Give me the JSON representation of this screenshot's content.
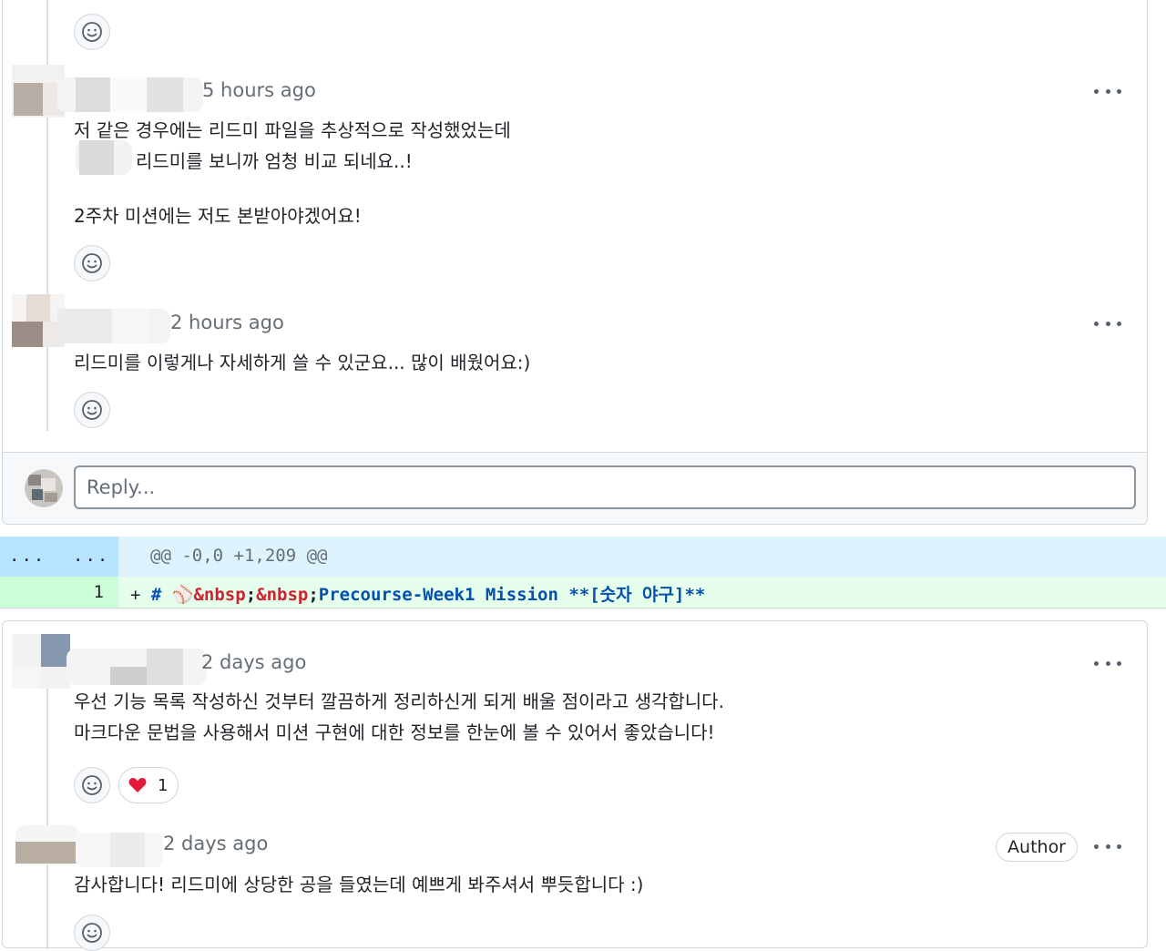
{
  "thread1": {
    "comments": [
      {
        "time": "5 hours ago",
        "lines": [
          "저 같은 경우에는 리드미 파일을 추상적으로 작성했었는데",
          "리드미를 보니까 엄청 비교 되네요..!",
          "2주차 미션에는 저도 본받아야겠어요!"
        ]
      },
      {
        "time": "2 hours ago",
        "lines": [
          "리드미를 이렇게나 자세하게 쓸 수 있군요... 많이 배웠어요:)"
        ]
      }
    ],
    "reply_placeholder": "Reply..."
  },
  "diff": {
    "expand_left": "...",
    "expand_right": "...",
    "hunk_header": "@@ -0,0 +1,209 @@",
    "line_number": "1",
    "plus": "+",
    "code_hash": "#",
    "code_emoji": "⚾",
    "code_nbsp1": "&nbsp",
    "code_semi1": ";",
    "code_nbsp2": "&nbsp",
    "code_semi2": ";",
    "code_title": "Precourse-Week1 Mission ",
    "code_bold": "**[숫자 야구]**"
  },
  "thread2": {
    "comments": [
      {
        "time": "2 days ago",
        "lines": [
          "우선 기능 목록 작성하신 것부터 깔끔하게 정리하신게 되게 배울 점이라고 생각합니다.",
          "마크다운 문법을 사용해서 미션 구현에 대한 정보를 한눈에 볼 수 있어서 좋았습니다!"
        ],
        "reaction": {
          "emoji": "heart-icon",
          "count": "1"
        }
      },
      {
        "time": "2 days ago",
        "badge": "Author",
        "lines": [
          "감사합니다! 리드미에 상당한 공을 들였는데 예쁘게 봐주셔서 뿌듯합니다 :)"
        ]
      }
    ]
  },
  "colors": {
    "border": "#d0d7de",
    "muted": "#656d76",
    "hunk_bg": "#ddf4ff",
    "hunk_gutter": "#b6e3ff",
    "add_bg": "#e6ffec",
    "add_gutter": "#ccffd8",
    "heading_blue": "#0550ae",
    "entity_red": "#cf222e"
  }
}
